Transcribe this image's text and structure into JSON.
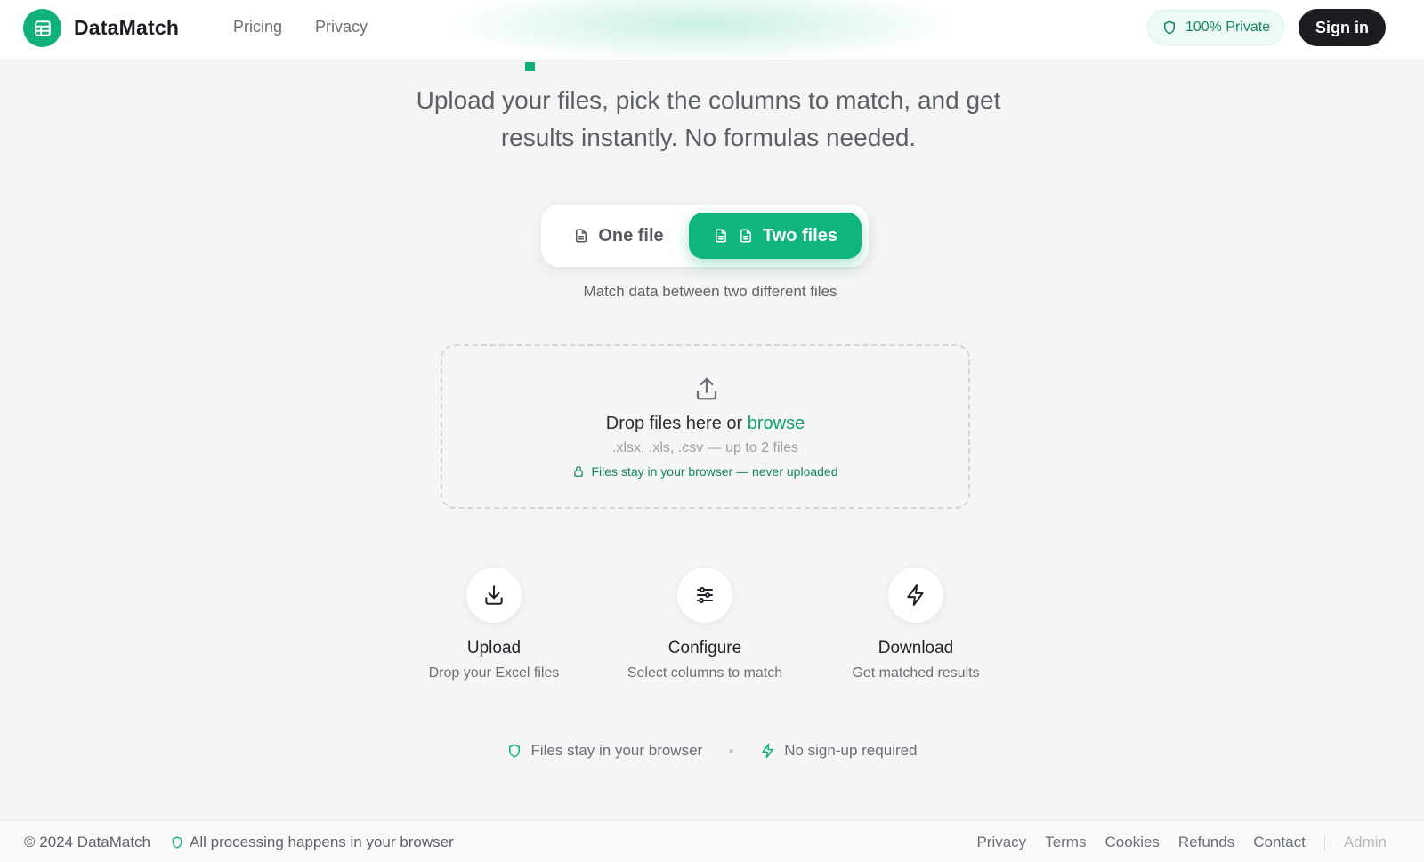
{
  "header": {
    "brand_name": "DataMatch",
    "nav": [
      "Pricing",
      "Privacy"
    ],
    "private_badge": "100% Private",
    "signin_label": "Sign in"
  },
  "hero": {
    "subtitle_line1": "Upload your files, pick the columns to match, and get",
    "subtitle_line2": "results instantly. No formulas needed."
  },
  "mode_toggle": {
    "options": [
      "One file",
      "Two files"
    ],
    "selected": "Two files",
    "description": "Match data between two different files"
  },
  "dropzone": {
    "main_text": "Drop files here or ",
    "browse_text": "browse",
    "file_types": ".xlsx, .xls, .csv — up to 2 files",
    "privacy_note": "Files stay in your browser — never uploaded"
  },
  "steps": [
    {
      "title": "Upload",
      "description": "Drop your Excel files",
      "icon": "download-icon"
    },
    {
      "title": "Configure",
      "description": "Select columns to match",
      "icon": "sliders-icon"
    },
    {
      "title": "Download",
      "description": "Get matched results",
      "icon": "lightning-icon"
    }
  ],
  "trust": {
    "item1": "Files stay in your browser",
    "item2": "No sign-up required"
  },
  "footer": {
    "copyright": "© 2024 DataMatch",
    "processing_note": "All processing happens in your browser",
    "links": [
      "Privacy",
      "Terms",
      "Cookies",
      "Refunds",
      "Contact"
    ],
    "admin_label": "Admin"
  },
  "colors": {
    "accent": "#10b57e",
    "accent_dark": "#14865e",
    "signin_bg": "#1b1d20",
    "page_bg": "#f5f5f6"
  }
}
